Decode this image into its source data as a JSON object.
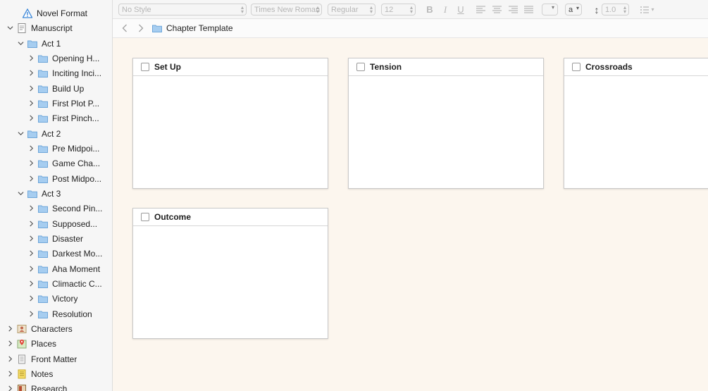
{
  "binder": {
    "items": [
      {
        "label": "Novel Format",
        "icon": "warning-icon"
      },
      {
        "label": "Manuscript",
        "icon": "manuscript-icon"
      },
      {
        "label": "Act 1",
        "icon": "folder-icon"
      },
      {
        "label": "Opening H...",
        "icon": "folder-icon"
      },
      {
        "label": "Inciting Inci...",
        "icon": "folder-icon"
      },
      {
        "label": "Build Up",
        "icon": "folder-icon"
      },
      {
        "label": "First Plot P...",
        "icon": "folder-icon"
      },
      {
        "label": "First Pinch...",
        "icon": "folder-icon"
      },
      {
        "label": "Act 2",
        "icon": "folder-icon"
      },
      {
        "label": "Pre Midpoi...",
        "icon": "folder-icon"
      },
      {
        "label": "Game Cha...",
        "icon": "folder-icon"
      },
      {
        "label": "Post Midpo...",
        "icon": "folder-icon"
      },
      {
        "label": "Act 3",
        "icon": "folder-icon"
      },
      {
        "label": "Second Pin...",
        "icon": "folder-icon"
      },
      {
        "label": "Supposed...",
        "icon": "folder-icon"
      },
      {
        "label": "Disaster",
        "icon": "folder-icon"
      },
      {
        "label": "Darkest Mo...",
        "icon": "folder-icon"
      },
      {
        "label": "Aha Moment",
        "icon": "folder-icon"
      },
      {
        "label": "Climactic C...",
        "icon": "folder-icon"
      },
      {
        "label": "Victory",
        "icon": "folder-icon"
      },
      {
        "label": "Resolution",
        "icon": "folder-icon"
      },
      {
        "label": "Characters",
        "icon": "characters-icon"
      },
      {
        "label": "Places",
        "icon": "places-icon"
      },
      {
        "label": "Front Matter",
        "icon": "front-matter-icon"
      },
      {
        "label": "Notes",
        "icon": "notes-icon"
      },
      {
        "label": "Research",
        "icon": "research-icon"
      }
    ]
  },
  "toolbar": {
    "style": "No Style",
    "font": "Times New Roman",
    "weight": "Regular",
    "size": "12",
    "bold": "B",
    "italic": "I",
    "underline": "U",
    "highlight": "a",
    "line_spacing": "1.0"
  },
  "pathbar": {
    "title": "Chapter Template"
  },
  "cards": [
    {
      "title": "Set Up"
    },
    {
      "title": "Tension"
    },
    {
      "title": "Crossroads"
    },
    {
      "title": "Outcome"
    }
  ],
  "colors": {
    "folder": "#a6cdf0",
    "corkboard": "#fcf6ee",
    "warning": "#3a86d8"
  }
}
